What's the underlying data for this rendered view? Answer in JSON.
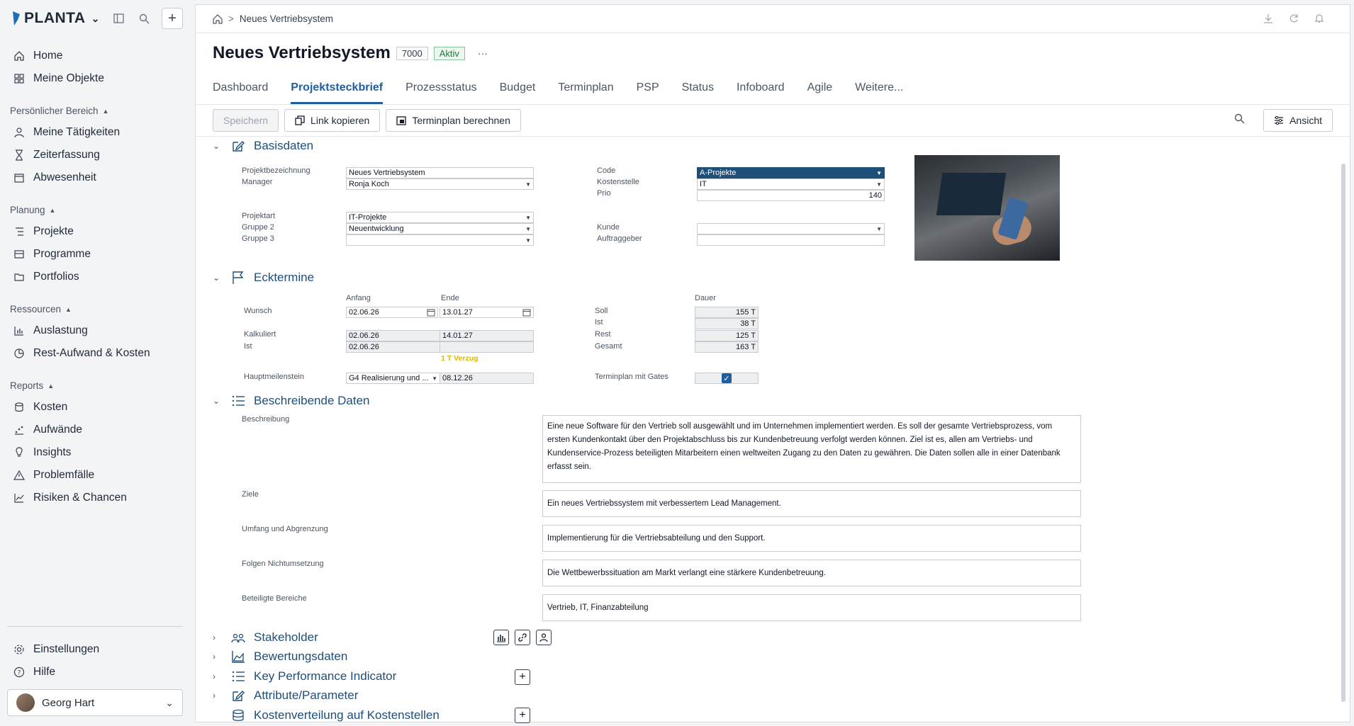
{
  "brand": {
    "name": "PLANTA"
  },
  "sidebar": {
    "top_items": [
      {
        "label": "Home",
        "icon": "home-icon"
      },
      {
        "label": "Meine Objekte",
        "icon": "grid-icon"
      }
    ],
    "sections": [
      {
        "title": "Persönlicher Bereich",
        "items": [
          "Meine Tätigkeiten",
          "Zeiterfassung",
          "Abwesenheit"
        ]
      },
      {
        "title": "Planung",
        "items": [
          "Projekte",
          "Programme",
          "Portfolios"
        ]
      },
      {
        "title": "Ressourcen",
        "items": [
          "Auslastung",
          "Rest-Aufwand & Kosten"
        ]
      },
      {
        "title": "Reports",
        "items": [
          "Kosten",
          "Aufwände",
          "Insights",
          "Problemfälle",
          "Risiken & Chancen"
        ]
      }
    ],
    "bottom_items": [
      "Einstellungen",
      "Hilfe"
    ],
    "user": "Georg Hart"
  },
  "breadcrumb": {
    "current": "Neues Vertriebsystem"
  },
  "project": {
    "title": "Neues Vertriebsystem",
    "id": "7000",
    "status": "Aktiv",
    "more": "···"
  },
  "tabs": [
    "Dashboard",
    "Projektsteckbrief",
    "Prozessstatus",
    "Budget",
    "Terminplan",
    "PSP",
    "Status",
    "Infoboard",
    "Agile",
    "Weitere..."
  ],
  "active_tab": "Projektsteckbrief",
  "toolbar": {
    "save": "Speichern",
    "copy_link": "Link kopieren",
    "calc_schedule": "Terminplan berechnen",
    "view": "Ansicht"
  },
  "basisdaten": {
    "title": "Basisdaten",
    "projektbezeichnung_label": "Projektbezeichnung",
    "projektbezeichnung": "Neues Vertriebsystem",
    "manager_label": "Manager",
    "manager": "Ronja Koch",
    "projektart_label": "Projektart",
    "projektart": "IT-Projekte",
    "gruppe2_label": "Gruppe 2",
    "gruppe2": "Neuentwicklung",
    "gruppe3_label": "Gruppe 3",
    "gruppe3": "",
    "code_label": "Code",
    "code": "A-Projekte",
    "kostenstelle_label": "Kostenstelle",
    "kostenstelle": "IT",
    "prio_label": "Prio",
    "prio": "140",
    "kunde_label": "Kunde",
    "kunde": "",
    "auftraggeber_label": "Auftraggeber",
    "auftraggeber": ""
  },
  "ecktermine": {
    "title": "Ecktermine",
    "anfang_label": "Anfang",
    "ende_label": "Ende",
    "dauer_label": "Dauer",
    "wunsch_label": "Wunsch",
    "wunsch_anfang": "02.06.26",
    "wunsch_ende": "13.01.27",
    "kalkuliert_label": "Kalkuliert",
    "kalk_anfang": "02.06.26",
    "kalk_ende": "14.01.27",
    "ist_label": "Ist",
    "ist_anfang": "02.06.26",
    "ist_ende": "",
    "verzug": "1 T Verzug",
    "hauptmeilenstein_label": "Hauptmeilenstein",
    "hauptmeilenstein": "G4 Realisierung und ...",
    "hauptmeilenstein_datum": "08.12.26",
    "soll_label": "Soll",
    "soll": "155 T",
    "ist_d_label": "Ist",
    "ist_d": "38 T",
    "rest_label": "Rest",
    "rest": "125 T",
    "gesamt_label": "Gesamt",
    "gesamt": "163 T",
    "gates_label": "Terminplan mit Gates"
  },
  "beschreibende": {
    "title": "Beschreibende Daten",
    "beschreibung_label": "Beschreibung",
    "beschreibung": "Eine neue Software für den Vertrieb soll ausgewählt und im Unternehmen implementiert werden. Es soll der gesamte Vertriebsprozess, vom ersten Kundenkontakt über den Projektabschluss bis zur Kundenbetreuung verfolgt werden können. Ziel ist es, allen am Vertriebs- und Kundenservice-Prozess beteiligten Mitarbeitern einen weltweiten Zugang zu den Daten zu gewähren. Die Daten sollen alle in einer Datenbank erfasst sein.",
    "ziele_label": "Ziele",
    "ziele": "Ein neues Vertriebssystem mit verbessertem Lead Management.",
    "umfang_label": "Umfang und Abgrenzung",
    "umfang": "Implementierung für die Vertriebsabteilung und den Support.",
    "folgen_label": "Folgen Nichtumsetzung",
    "folgen": "Die Wettbewerbssituation am Markt verlangt eine stärkere Kundenbetreuung.",
    "bereiche_label": "Beteiligte Bereiche",
    "bereiche": "Vertrieb, IT, Finanzabteilung"
  },
  "collapsed_sections": [
    "Stakeholder",
    "Bewertungsdaten",
    "Key Performance Indicator",
    "Attribute/Parameter",
    "Kostenverteilung auf Kostenstellen"
  ],
  "colors": {
    "accent": "#1f5f9e",
    "heading": "#1f4e79",
    "status_green": "#1e7a3d",
    "warning": "#e0b800"
  }
}
